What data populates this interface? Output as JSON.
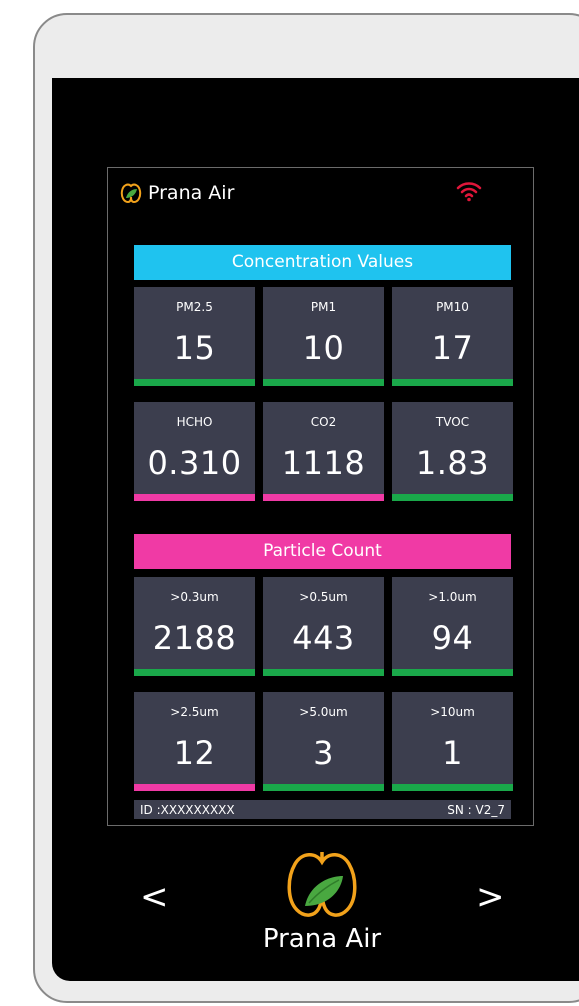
{
  "brand": {
    "name": "Prana Air"
  },
  "colors": {
    "good": "#1aa84a",
    "bad": "#f03aa5",
    "concentration_header": "#1fc3ef",
    "particle_header": "#f03aa5",
    "tile_bg": "#3c3e4e",
    "wifi": "#e0163a"
  },
  "status_icons": {
    "wifi": "wifi-icon"
  },
  "concentration": {
    "title": "Concentration Values",
    "tiles": [
      {
        "label": "PM2.5",
        "value": "15",
        "status": "good"
      },
      {
        "label": "PM1",
        "value": "10",
        "status": "good"
      },
      {
        "label": "PM10",
        "value": "17",
        "status": "good"
      },
      {
        "label": "HCHO",
        "value": "0.310",
        "status": "bad"
      },
      {
        "label": "CO2",
        "value": "1118",
        "status": "bad"
      },
      {
        "label": "TVOC",
        "value": "1.83",
        "status": "good"
      }
    ]
  },
  "particle": {
    "title": "Particle Count",
    "tiles": [
      {
        "label": ">0.3um",
        "value": "2188",
        "status": "good"
      },
      {
        "label": ">0.5um",
        "value": "443",
        "status": "good"
      },
      {
        "label": ">1.0um",
        "value": "94",
        "status": "good"
      },
      {
        "label": ">2.5um",
        "value": "12",
        "status": "bad"
      },
      {
        "label": ">5.0um",
        "value": "3",
        "status": "good"
      },
      {
        "label": ">10um",
        "value": "1",
        "status": "good"
      }
    ]
  },
  "footer": {
    "id": "ID :XXXXXXXXX",
    "sn": "SN : V2_7"
  },
  "nav": {
    "prev": "<",
    "next": ">"
  },
  "logo": {
    "text": "Prana Air"
  }
}
